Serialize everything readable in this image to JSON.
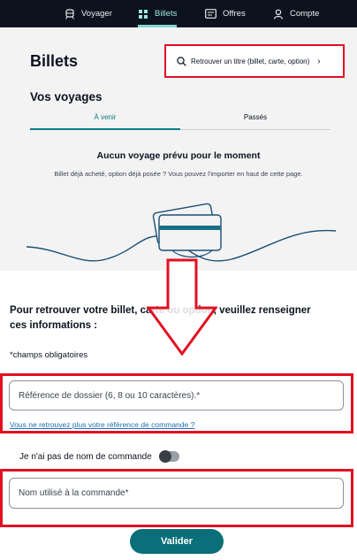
{
  "nav": {
    "items": [
      {
        "label": "Voyager",
        "icon": "train-icon"
      },
      {
        "label": "Billets",
        "icon": "ticket-grid-icon",
        "active": true
      },
      {
        "label": "Offres",
        "icon": "card-icon"
      },
      {
        "label": "Compte",
        "icon": "user-icon"
      }
    ]
  },
  "header": {
    "title": "Billets",
    "search_label": "Retrouver un titre (billet, carte, option)",
    "search_chevron": "›"
  },
  "voyages": {
    "title": "Vos voyages",
    "tabs": [
      {
        "label": "À venir",
        "active": true
      },
      {
        "label": "Passés",
        "active": false
      }
    ],
    "empty_title": "Aucun voyage prévu pour le moment",
    "empty_text": "Billet déjà acheté, option déjà posée ? Vous pouvez l'importer en haut de cette page."
  },
  "form": {
    "intro": "Pour retrouver votre billet, carte ou option, veuillez renseigner ces informations :",
    "required_note": "*champs obligatoires",
    "reference_placeholder": "Référence de dossier (6, 8 ou 10 caractères).*",
    "help_link": "Vous ne retrouvez plus votre référence de commande ?",
    "toggle_label": "Je n'ai pas de nom de commande",
    "name_placeholder": "Nom utilisé à la commande*",
    "submit_label": "Valider"
  },
  "colors": {
    "nav_bg": "#0c131f",
    "accent": "#0a7c84",
    "highlight": "#e10f21"
  }
}
